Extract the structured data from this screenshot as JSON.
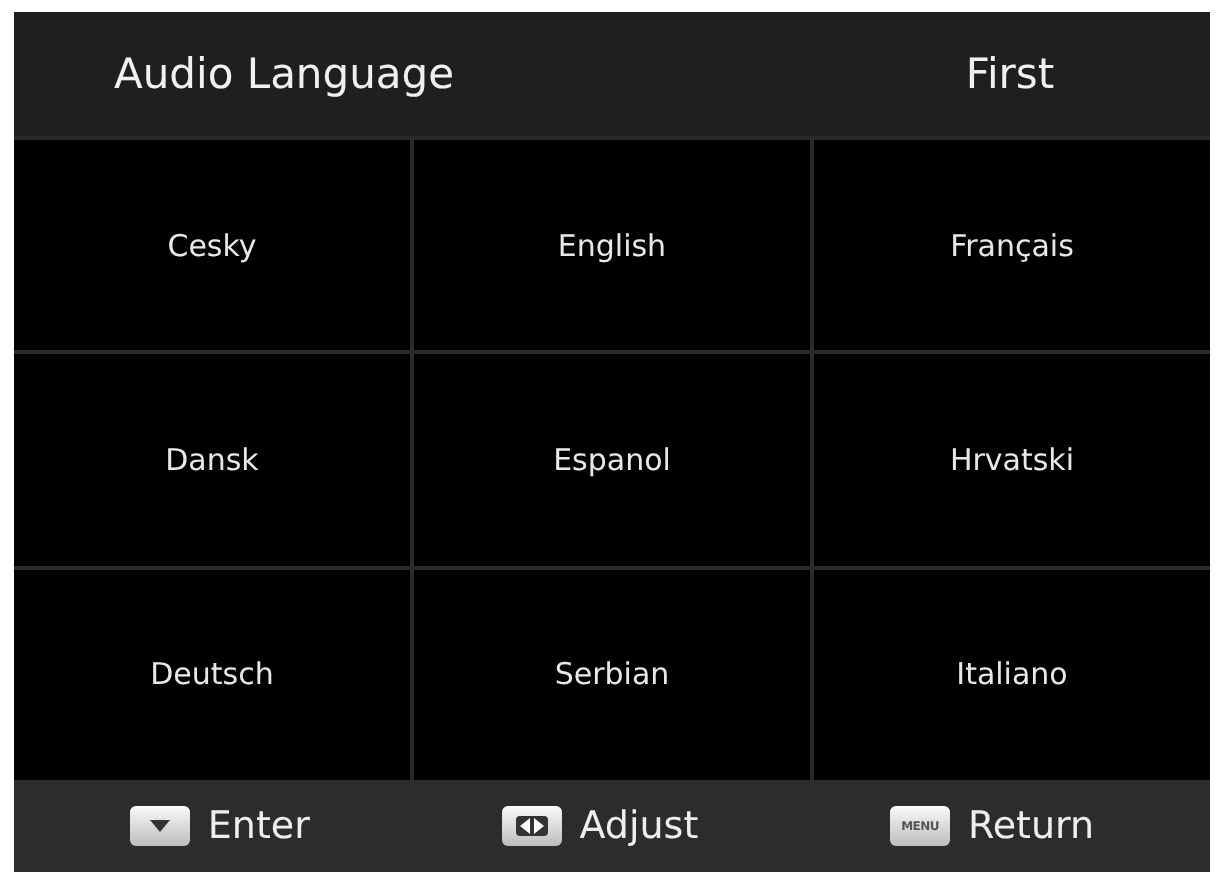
{
  "header": {
    "title": "Audio Language",
    "value": "First"
  },
  "languages": [
    {
      "label": "Cesky"
    },
    {
      "label": "English"
    },
    {
      "label": "Français"
    },
    {
      "label": "Dansk"
    },
    {
      "label": "Espanol"
    },
    {
      "label": "Hrvatski"
    },
    {
      "label": "Deutsch"
    },
    {
      "label": "Serbian"
    },
    {
      "label": "Italiano"
    }
  ],
  "footer": [
    {
      "kind": "down",
      "label": "Enter"
    },
    {
      "kind": "leftright",
      "label": "Adjust"
    },
    {
      "kind": "menu",
      "key_label": "MENU",
      "label": "Return"
    }
  ]
}
